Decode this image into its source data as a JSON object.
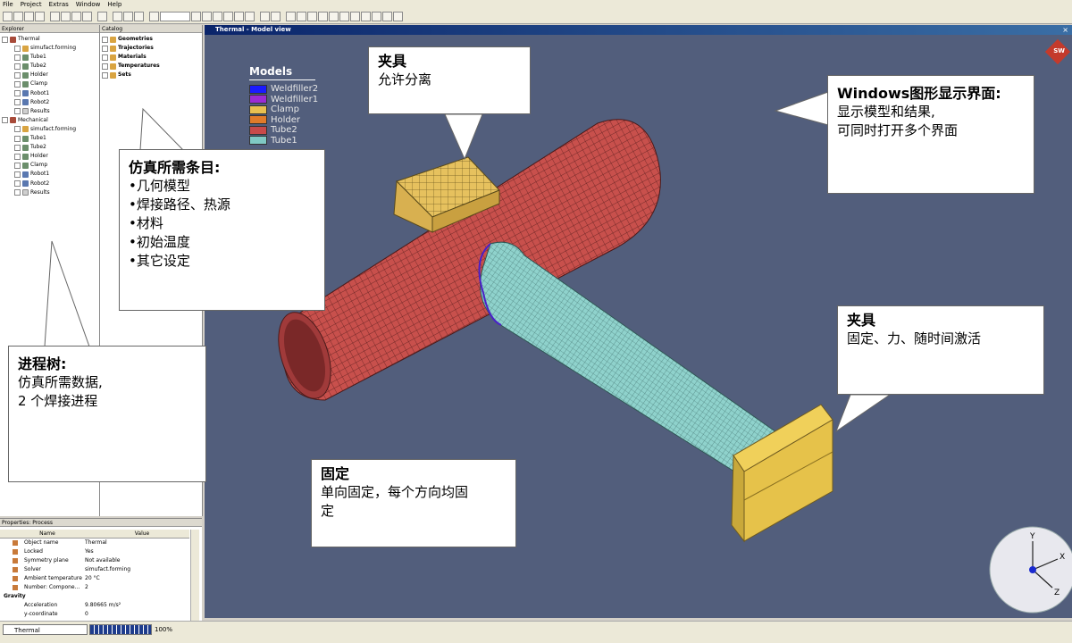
{
  "menu": [
    "File",
    "Project",
    "Extras",
    "Window",
    "Help"
  ],
  "explorer": {
    "title": "Explorer",
    "items": [
      {
        "label": "Thermal",
        "icon": "process-icon",
        "depth": 0
      },
      {
        "label": "simufact.forming",
        "icon": "solver-icon",
        "depth": 1
      },
      {
        "label": "Tube1",
        "icon": "part-icon",
        "depth": 1
      },
      {
        "label": "Tube2",
        "icon": "part-icon",
        "depth": 1
      },
      {
        "label": "Holder",
        "icon": "part-icon",
        "depth": 1
      },
      {
        "label": "Clamp",
        "icon": "part-icon",
        "depth": 1
      },
      {
        "label": "Robot1",
        "icon": "robot-icon",
        "depth": 1
      },
      {
        "label": "Robot2",
        "icon": "robot-icon",
        "depth": 1
      },
      {
        "label": "Results",
        "icon": "results-icon",
        "depth": 1
      },
      {
        "label": "Mechanical",
        "icon": "process-icon",
        "depth": 0
      },
      {
        "label": "simufact.forming",
        "icon": "solver-icon",
        "depth": 1
      },
      {
        "label": "Tube1",
        "icon": "part-icon",
        "depth": 1
      },
      {
        "label": "Tube2",
        "icon": "part-icon",
        "depth": 1
      },
      {
        "label": "Holder",
        "icon": "part-icon",
        "depth": 1
      },
      {
        "label": "Clamp",
        "icon": "part-icon",
        "depth": 1
      },
      {
        "label": "Robot1",
        "icon": "robot-icon",
        "depth": 1
      },
      {
        "label": "Robot2",
        "icon": "robot-icon",
        "depth": 1
      },
      {
        "label": "Results",
        "icon": "results-icon",
        "depth": 1
      }
    ]
  },
  "catalog": {
    "title": "Catalog",
    "items": [
      "Geometries",
      "Trajectories",
      "Materials",
      "Temperatures",
      "Sets"
    ]
  },
  "properties": {
    "title": "Properties: Process",
    "col_name": "Name",
    "col_value": "Value",
    "rows": [
      {
        "name": "Object name",
        "value": "Thermal"
      },
      {
        "name": "Locked",
        "value": "Yes"
      },
      {
        "name": "Symmetry plane",
        "value": "Not available"
      },
      {
        "name": "Solver",
        "value": "simufact.forming"
      },
      {
        "name": "Ambient temperature",
        "value": "20 °C"
      },
      {
        "name": "Number: Compone...",
        "value": "2"
      }
    ],
    "group": "Gravity",
    "group_rows": [
      {
        "name": "Acceleration",
        "value": "9.80665 m/s²"
      },
      {
        "name": "y-coordinate",
        "value": "0"
      }
    ]
  },
  "status": {
    "process": "Thermal",
    "progress_label": "100%",
    "progress": 1.0
  },
  "viewport": {
    "title": "Thermal - Model view",
    "close": "×",
    "logo": "SW",
    "legend_title": "Models",
    "legend": [
      {
        "name": "Weldfiller2",
        "color": "#1a1aff"
      },
      {
        "name": "Weldfiller1",
        "color": "#9a2bd6"
      },
      {
        "name": "Clamp",
        "color": "#e8c050"
      },
      {
        "name": "Holder",
        "color": "#e07b2a"
      },
      {
        "name": "Tube2",
        "color": "#c84a4a"
      },
      {
        "name": "Tube1",
        "color": "#7fc9c4"
      }
    ],
    "axes": {
      "y": "Y",
      "x": "X",
      "z": "Z"
    }
  },
  "callouts": {
    "clamp": {
      "title": "夹具",
      "lines": [
        "允许分离"
      ]
    },
    "window": {
      "title": "Windows图形显示界面:",
      "lines": [
        "显示模型和结果,",
        "可同时打开多个界面"
      ]
    },
    "catalog": {
      "title": "仿真所需条目:",
      "lines": [
        "•几何模型",
        "•焊接路径、热源",
        "•材料",
        "•初始温度",
        "•其它设定"
      ]
    },
    "fixture": {
      "title": "夹具",
      "lines": [
        "固定、力、随时间激活"
      ]
    },
    "tree": {
      "title": "进程树:",
      "lines": [
        "仿真所需数据,",
        "2 个焊接进程"
      ]
    },
    "fixed": {
      "title": "固定",
      "lines": [
        "单向固定，每个方向均固",
        "定"
      ]
    }
  }
}
